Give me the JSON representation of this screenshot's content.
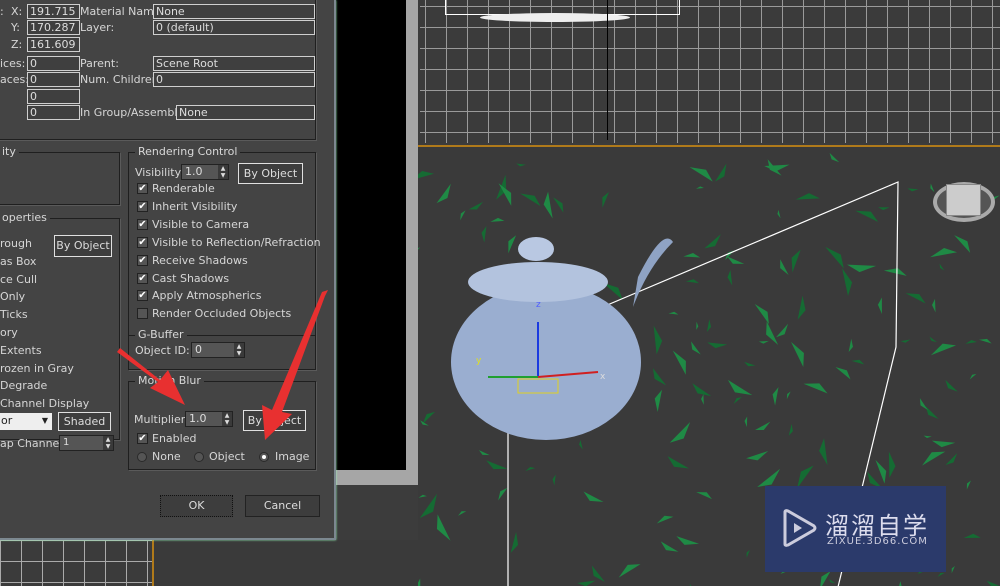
{
  "dialog": {
    "coords": {
      "x_label": "X:",
      "x": "191.715",
      "y_label": "Y:",
      "y": "170.287",
      "z_label": "Z:",
      "z": "161.609",
      "prefix": ":"
    },
    "counts": {
      "vertices_label": "ices:",
      "vertices": "0",
      "faces_label": "aces:",
      "faces": "0",
      "extra1": "0",
      "extra2": "0"
    },
    "info": {
      "material_label": "Material Name:",
      "material": "None",
      "layer_label": "Layer:",
      "layer": "0 (default)",
      "parent_label": "Parent:",
      "parent": "Scene Root",
      "children_label": "Num. Children:",
      "children": "0",
      "group_label": "In Group/Assembly:",
      "group": "None"
    },
    "interactivity": {
      "title": "ity"
    },
    "display": {
      "title": "operties",
      "by_object": "By Object",
      "items": [
        "rough",
        "as Box",
        "ce Cull",
        "Only",
        "Ticks",
        "ory",
        "Extents",
        "rozen in Gray",
        "Degrade",
        "Channel Display"
      ],
      "dropdown": "or",
      "shaded": "Shaded",
      "map_channel_label": "ap Channel:",
      "map_channel": "1"
    },
    "rendering": {
      "title": "Rendering Control",
      "visibility_label": "Visibility:",
      "visibility": "1.0",
      "by_object": "By Object",
      "options": [
        {
          "label": "Renderable",
          "checked": true
        },
        {
          "label": "Inherit Visibility",
          "checked": true
        },
        {
          "label": "Visible to Camera",
          "checked": true
        },
        {
          "label": "Visible to Reflection/Refraction",
          "checked": true
        },
        {
          "label": "Receive Shadows",
          "checked": true
        },
        {
          "label": "Cast Shadows",
          "checked": true
        },
        {
          "label": "Apply Atmospherics",
          "checked": true
        },
        {
          "label": "Render Occluded Objects",
          "checked": false
        }
      ]
    },
    "gbuffer": {
      "title": "G-Buffer",
      "object_id_label": "Object ID:",
      "object_id": "0"
    },
    "motion_blur": {
      "title": "Motion Blur",
      "multiplier_label": "Multiplier:",
      "multiplier": "1.0",
      "by_object": "By Object",
      "enabled_label": "Enabled",
      "enabled": true,
      "modes": [
        "None",
        "Object",
        "Image"
      ],
      "selected": "Image"
    },
    "ok": "OK",
    "cancel": "Cancel"
  },
  "viewport": {
    "axis_x": "x",
    "axis_y": "y",
    "axis_z": "z"
  },
  "watermark": {
    "name": "溜溜自学",
    "url": "ZIXUE.3D66.COM"
  },
  "colors": {
    "annotation_arrow": "#e83030",
    "foliage": "#1f8a45",
    "teapot": "#9aaed0",
    "watermark_bg": "#2b3a6b"
  }
}
